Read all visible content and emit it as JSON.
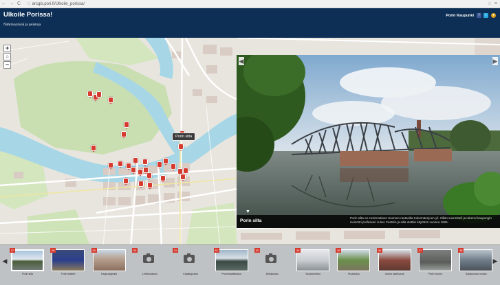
{
  "browser": {
    "url": "arcgis.pori.fi/Ulkoile_porissa/",
    "lock_icon": "page-icon",
    "back_glyph": "←",
    "forward_glyph": "→",
    "reload_glyph": "C",
    "star_glyph": "☆",
    "menu_glyph": "≡"
  },
  "header": {
    "title": "Ulkoile Porissa!",
    "subtitle": "Nähtävyyksiä ja puistoja",
    "org": "Porin Kaupunki",
    "facebook": "f",
    "twitter": "t",
    "other": "●"
  },
  "map": {
    "zoom_in": "+",
    "home": "⌂",
    "zoom_out": "−",
    "tooltip": "Porin silta",
    "colors": {
      "land": "#e8e5df",
      "park": "#c9dfb2",
      "water": "#a7d7e6",
      "road_major": "#ffffff",
      "building": "#d8ccc4",
      "marker": "#d63b2f"
    }
  },
  "panel": {
    "prev": "◀",
    "next": "▶",
    "caption_title": "Porin silta",
    "caption_text": "Porin silta on ensimmäinen Suomen rautasilta Kokemäenjoen yli. Sillan suunnitteli ja rakensi kaupungin insinööri professori Julius Castrén ja silta otettiin käyttöön vuonna 1926.",
    "close": "▼"
  },
  "strip": {
    "prev": "◀",
    "next": "▶",
    "items": [
      {
        "num": "27",
        "label": "Porin silta",
        "kind": "photo",
        "palette": "bridge"
      },
      {
        "num": "28",
        "label": "Porin teatteri",
        "kind": "photo",
        "palette": "blue"
      },
      {
        "num": "29",
        "label": "Kaupungintalo",
        "kind": "photo",
        "palette": "building"
      },
      {
        "num": "30",
        "label": "Lehtikuusikko",
        "kind": "camera"
      },
      {
        "num": "31",
        "label": "Kirjastopuisto",
        "kind": "camera"
      },
      {
        "num": "32",
        "label": "Promenadikeskus",
        "kind": "photo",
        "palette": "river"
      },
      {
        "num": "33",
        "label": "Eteläpuisto",
        "kind": "camera"
      },
      {
        "num": "34",
        "label": "Muistomerkki",
        "kind": "photo",
        "palette": "statue"
      },
      {
        "num": "35",
        "label": "Puuistutus",
        "kind": "photo",
        "palette": "tree"
      },
      {
        "num": "36",
        "label": "Vanha raatihuone",
        "kind": "photo",
        "palette": "redbuild"
      },
      {
        "num": "37",
        "label": "Porin museo",
        "kind": "photo",
        "palette": "gray"
      },
      {
        "num": "38",
        "label": "Satakunnan museo",
        "kind": "photo",
        "palette": "stones"
      }
    ]
  }
}
